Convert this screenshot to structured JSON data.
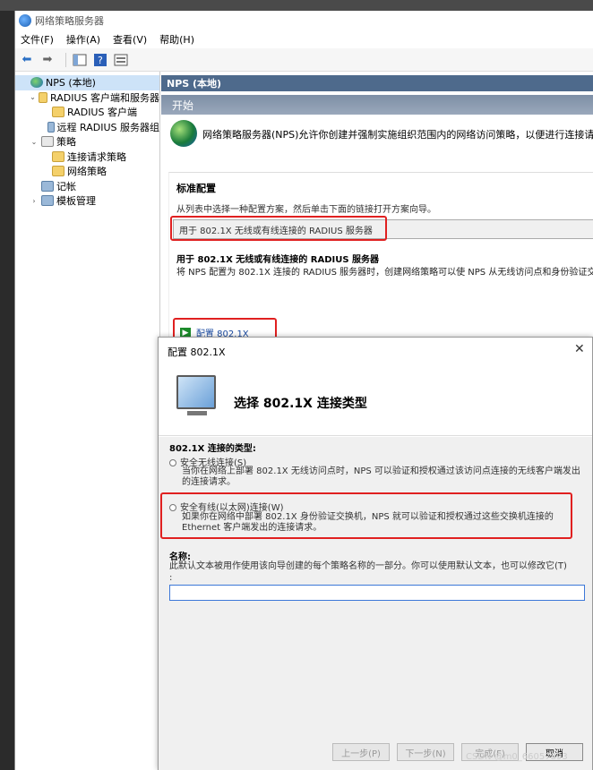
{
  "window": {
    "title": "网络策略服务器"
  },
  "menu": [
    "文件(F)",
    "操作(A)",
    "查看(V)",
    "帮助(H)"
  ],
  "tree": [
    {
      "label": "NPS (本地)",
      "depth": 0,
      "twisty": "",
      "icon": "globe"
    },
    {
      "label": "RADIUS 客户端和服务器",
      "depth": 1,
      "twisty": "⌄",
      "icon": "folder"
    },
    {
      "label": "RADIUS 客户端",
      "depth": 2,
      "twisty": "",
      "icon": "folder"
    },
    {
      "label": "远程 RADIUS 服务器组",
      "depth": 2,
      "twisty": "",
      "icon": "server"
    },
    {
      "label": "策略",
      "depth": 1,
      "twisty": "⌄",
      "icon": "doc"
    },
    {
      "label": "连接请求策略",
      "depth": 2,
      "twisty": "",
      "icon": "folder"
    },
    {
      "label": "网络策略",
      "depth": 2,
      "twisty": "",
      "icon": "folder"
    },
    {
      "label": "记帐",
      "depth": 1,
      "twisty": "",
      "icon": "server"
    },
    {
      "label": "模板管理",
      "depth": 1,
      "twisty": "›",
      "icon": "server"
    }
  ],
  "content": {
    "header": "NPS (本地)",
    "start": "开始",
    "intro": "网络策略服务器(NPS)允许你创建并强制实施组织范围内的网络访问策略，以便进行连接请求身份",
    "standard": {
      "title": "标准配置",
      "desc": "从列表中选择一种配置方案，然后单击下面的链接打开方案向导。",
      "selected": "用于 802.1X 无线或有线连接的 RADIUS 服务器",
      "sub_title": "用于 802.1X 无线或有线连接的 RADIUS 服务器",
      "sub_desc": "将 NPS 配置为 802.1X 连接的 RADIUS 服务器时，创建网络策略可以使 NPS 从无线访问点和身份验证交",
      "link": "配置 802.1X"
    }
  },
  "dialog": {
    "title": "配置 802.1X",
    "close": "✕",
    "heading": "选择 802.1X 连接类型",
    "type_label": "802.1X 连接的类型:",
    "option1": {
      "label": "安全无线连接(S)",
      "desc": "当你在网络上部署 802.1X 无线访问点时，NPS 可以验证和授权通过该访问点连接的无线客户端发出的连接请求。"
    },
    "option2": {
      "label": "安全有线(以太网)连接(W)",
      "desc": "如果你在网络中部署 802.1X 身份验证交换机，NPS 就可以验证和授权通过这些交换机连接的 Ethernet 客户端发出的连接请求。"
    },
    "name_label": "名称:",
    "name_desc": "此默认文本被用作使用该向导创建的每个策略名称的一部分。你可以使用默认文本，也可以修改它(T)\n:",
    "name_value": "",
    "buttons": {
      "prev": "上一步(P)",
      "next": "下一步(N)",
      "finish": "完成(F)",
      "cancel": "取消"
    }
  },
  "watermark": "CSDN @m0_66057893"
}
